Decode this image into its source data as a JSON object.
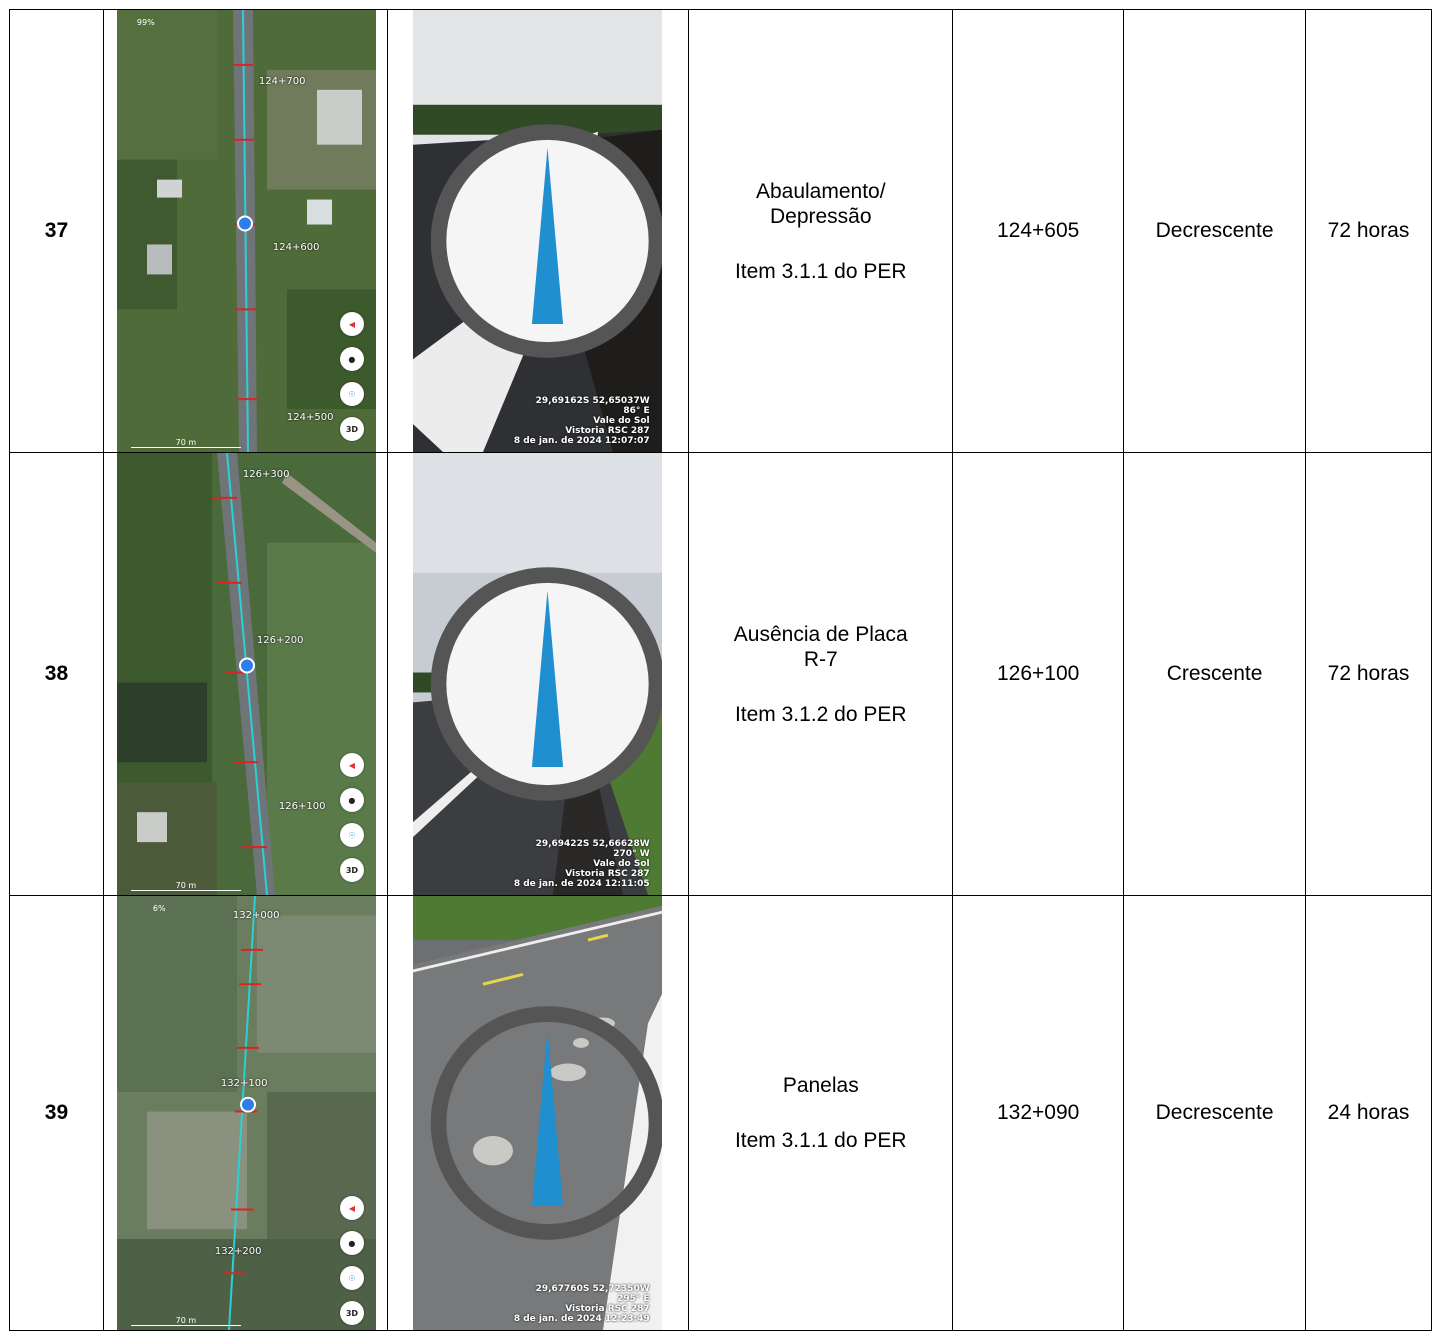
{
  "rows": [
    {
      "number": "37",
      "map": {
        "percent": "99%",
        "km_labels": [
          "124+700",
          "124+600",
          "124+500"
        ],
        "scale": "70 m",
        "btn_3d": "3D"
      },
      "photo": {
        "overlay": [
          "29,69162S 52,65037W",
          "86° E",
          "Vale do Sol",
          "Vistoria RSC 287",
          "8 de jan. de 2024 12:07:07"
        ]
      },
      "description": {
        "lines": [
          "Abaulamento/",
          "Depressão"
        ],
        "item": "Item 3.1.1 do PER"
      },
      "km": "124+605",
      "direction": "Decrescente",
      "deadline": "72 horas"
    },
    {
      "number": "38",
      "map": {
        "percent": "",
        "km_labels": [
          "126+300",
          "126+200",
          "126+100"
        ],
        "scale": "70 m",
        "btn_3d": "3D"
      },
      "photo": {
        "overlay": [
          "29,69422S 52,66628W",
          "270° W",
          "Vale do Sol",
          "Vistoria RSC 287",
          "8 de jan. de 2024 12:11:05"
        ]
      },
      "description": {
        "lines": [
          "Ausência de Placa",
          "R-7"
        ],
        "item": "Item 3.1.2 do PER"
      },
      "km": "126+100",
      "direction": "Crescente",
      "deadline": "72 horas"
    },
    {
      "number": "39",
      "map": {
        "percent": "6%",
        "km_labels": [
          "132+000",
          "132+100",
          "132+200"
        ],
        "scale": "70 m",
        "btn_3d": "3D"
      },
      "photo": {
        "overlay": [
          "29,67760S 52,72350W",
          "295° E",
          "Vistoria RSC 287",
          "8 de jan. de 2024 12:23:49"
        ]
      },
      "description": {
        "lines": [
          "Panelas"
        ],
        "item": "Item 3.1.1 do PER"
      },
      "km": "132+090",
      "direction": "Decrescente",
      "deadline": "24 horas"
    }
  ]
}
